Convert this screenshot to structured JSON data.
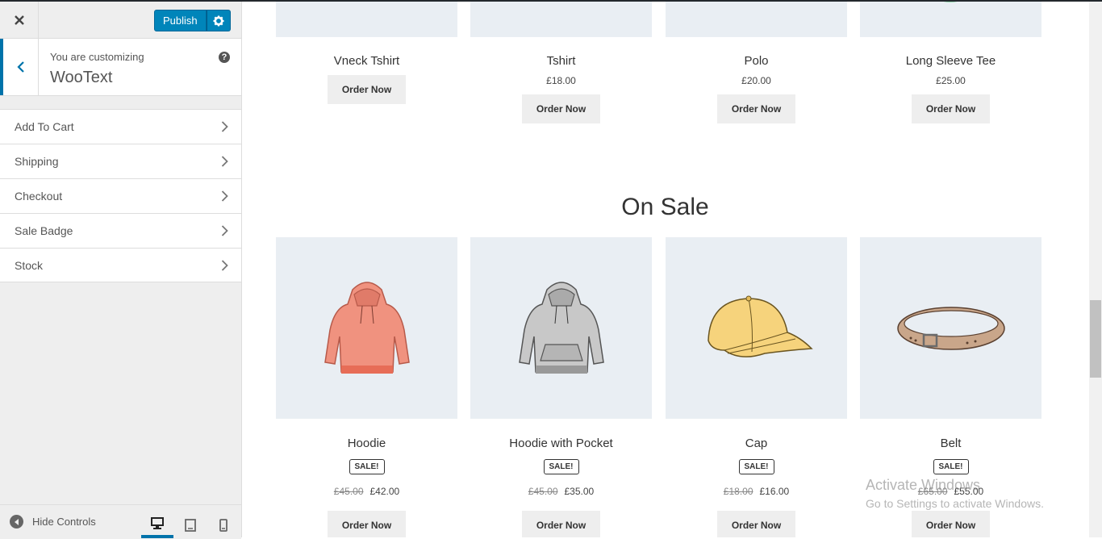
{
  "header": {
    "publish_label": "Publish"
  },
  "customizing": {
    "label": "You are customizing",
    "title": "WooText",
    "help": "?"
  },
  "menu": [
    {
      "label": "Add To Cart"
    },
    {
      "label": "Shipping"
    },
    {
      "label": "Checkout"
    },
    {
      "label": "Sale Badge"
    },
    {
      "label": "Stock"
    }
  ],
  "footer": {
    "hide_controls": "Hide Controls"
  },
  "top_products": [
    {
      "name": "Vneck Tshirt",
      "price": "",
      "button": "Order Now"
    },
    {
      "name": "Tshirt",
      "price": "£18.00",
      "button": "Order Now"
    },
    {
      "name": "Polo",
      "price": "£20.00",
      "button": "Order Now"
    },
    {
      "name": "Long Sleeve Tee",
      "price": "£25.00",
      "button": "Order Now"
    }
  ],
  "on_sale": {
    "title": "On Sale",
    "products": [
      {
        "name": "Hoodie",
        "badge": "SALE!",
        "old_price": "£45.00",
        "price": "£42.00",
        "button": "Order Now"
      },
      {
        "name": "Hoodie with Pocket",
        "badge": "SALE!",
        "old_price": "£45.00",
        "price": "£35.00",
        "button": "Order Now"
      },
      {
        "name": "Cap",
        "badge": "SALE!",
        "old_price": "£18.00",
        "price": "£16.00",
        "button": "Order Now"
      },
      {
        "name": "Belt",
        "badge": "SALE!",
        "old_price": "£65.00",
        "price": "£55.00",
        "button": "Order Now"
      }
    ]
  },
  "watermark": {
    "line1": "Activate Windows",
    "line2": "Go to Settings to activate Windows."
  },
  "colors": {
    "accent": "#0085ba",
    "product_bg": "#e9eef3",
    "button_bg": "#eeeeee"
  }
}
